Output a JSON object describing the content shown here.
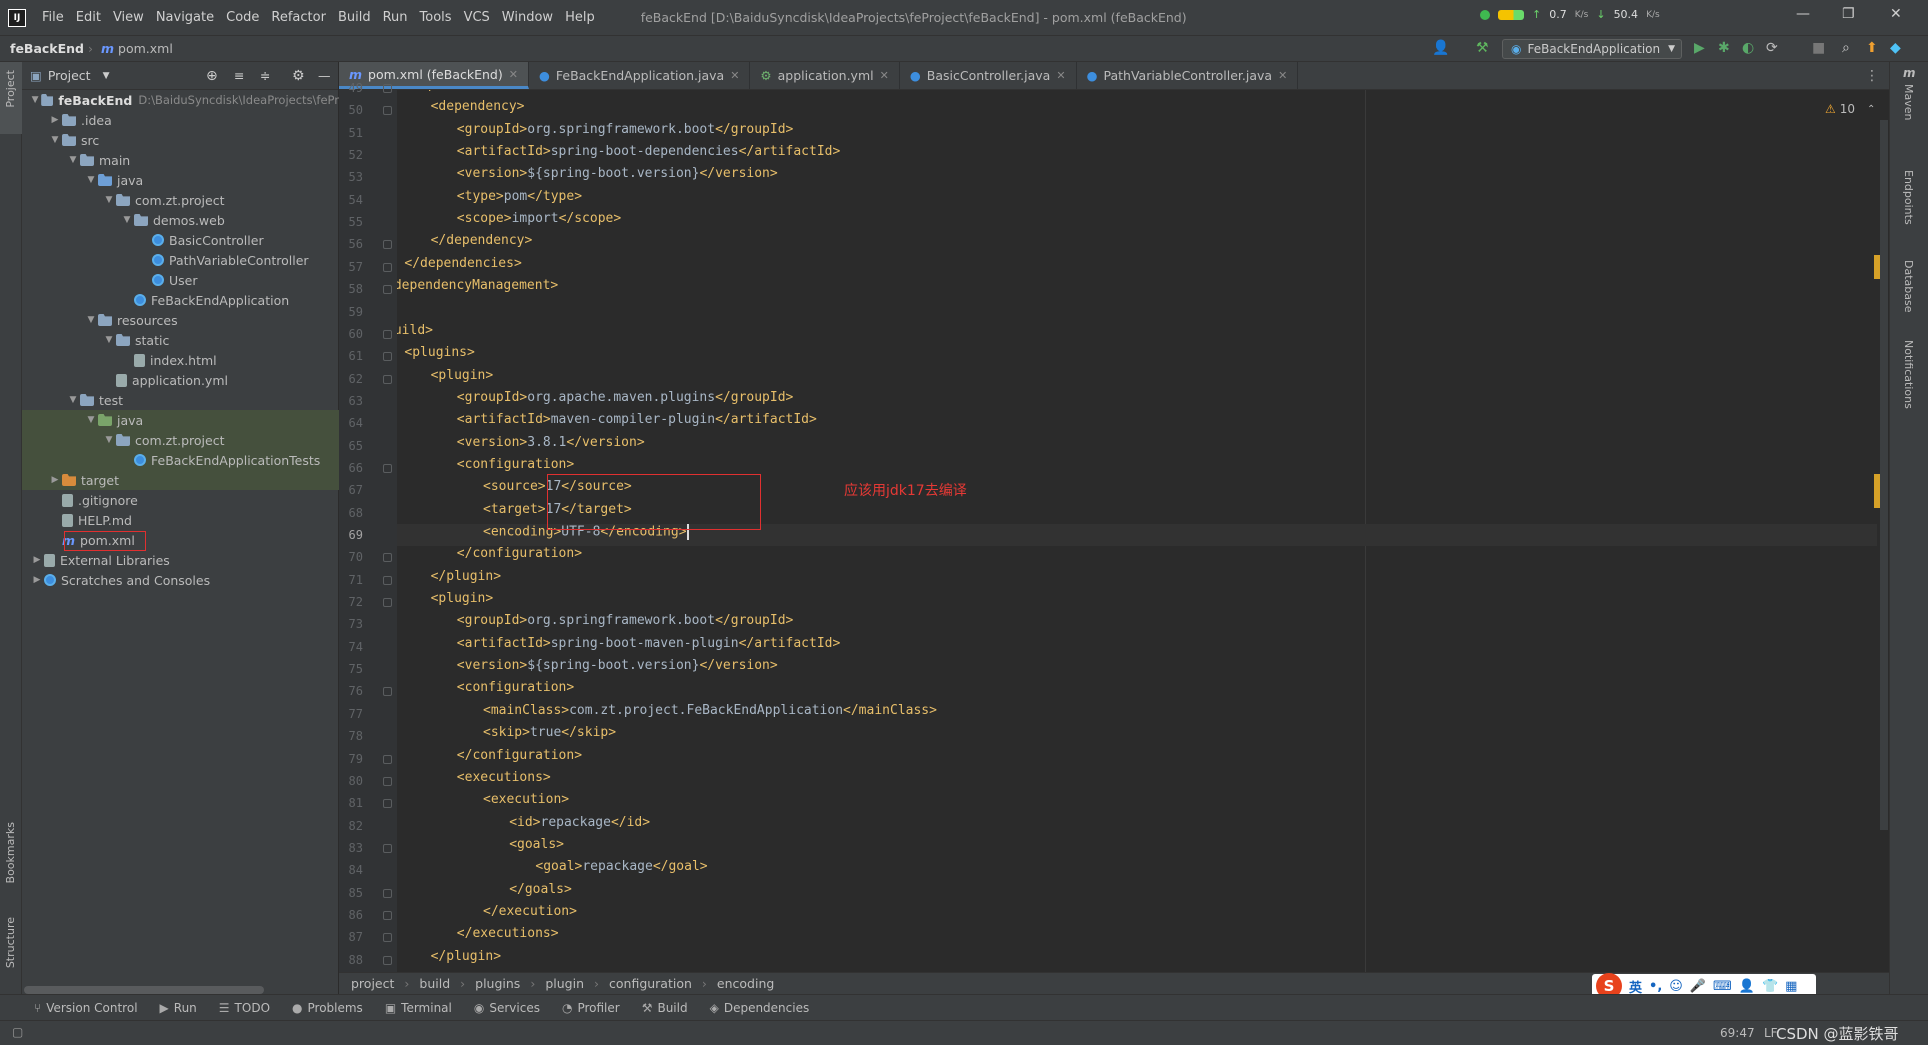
{
  "app": {
    "logo_text": "IJ",
    "menu": [
      "File",
      "Edit",
      "View",
      "Navigate",
      "Code",
      "Refactor",
      "Build",
      "Run",
      "Tools",
      "VCS",
      "Window",
      "Help"
    ],
    "window_title": "feBackEnd [D:\\BaiduSyncdisk\\IdeaProjects\\feProject\\feBackEnd] - pom.xml (feBackEnd)",
    "net_up": "0.7",
    "net_up_unit": "K/s",
    "net_down": "50.4",
    "net_down_unit": "K/s"
  },
  "navbar": {
    "project": "feBackEnd",
    "file": "pom.xml",
    "run_config": "FeBackEndApplication"
  },
  "project_panel": {
    "title": "Project",
    "tree": [
      {
        "label": "feBackEnd",
        "suffix": "D:\\BaiduSyncdisk\\IdeaProjects\\fePr",
        "icon": "folder-icon",
        "depth": 0,
        "expanded": true
      },
      {
        "label": ".idea",
        "icon": "folder-icon",
        "depth": 1,
        "expanded": false
      },
      {
        "label": "src",
        "icon": "folder-icon",
        "depth": 1,
        "expanded": true
      },
      {
        "label": "main",
        "icon": "folder-icon",
        "depth": 2,
        "expanded": true
      },
      {
        "label": "java",
        "icon": "source-folder-icon",
        "depth": 3,
        "expanded": true
      },
      {
        "label": "com.zt.project",
        "icon": "package-icon",
        "depth": 4,
        "expanded": true
      },
      {
        "label": "demos.web",
        "icon": "package-icon",
        "depth": 5,
        "expanded": true
      },
      {
        "label": "BasicController",
        "icon": "java-class-icon",
        "depth": 6
      },
      {
        "label": "PathVariableController",
        "icon": "java-class-icon",
        "depth": 6
      },
      {
        "label": "User",
        "icon": "java-class-icon",
        "depth": 6
      },
      {
        "label": "FeBackEndApplication",
        "icon": "spring-class-icon",
        "depth": 5
      },
      {
        "label": "resources",
        "icon": "resources-folder-icon",
        "depth": 3,
        "expanded": true
      },
      {
        "label": "static",
        "icon": "folder-icon",
        "depth": 4,
        "expanded": true
      },
      {
        "label": "index.html",
        "icon": "html-file-icon",
        "depth": 5
      },
      {
        "label": "application.yml",
        "icon": "yml-file-icon",
        "depth": 4
      },
      {
        "label": "test",
        "icon": "folder-icon",
        "depth": 2,
        "expanded": true
      },
      {
        "label": "java",
        "icon": "test-folder-icon",
        "depth": 3,
        "expanded": true
      },
      {
        "label": "com.zt.project",
        "icon": "package-icon",
        "depth": 4,
        "expanded": true
      },
      {
        "label": "FeBackEndApplicationTests",
        "icon": "spring-class-icon",
        "depth": 5
      },
      {
        "label": "target",
        "icon": "excluded-folder-icon",
        "depth": 1,
        "expanded": false
      },
      {
        "label": ".gitignore",
        "icon": "text-file-icon",
        "depth": 1
      },
      {
        "label": "HELP.md",
        "icon": "md-file-icon",
        "depth": 1
      },
      {
        "label": "pom.xml",
        "icon": "maven-file-icon",
        "depth": 1
      },
      {
        "label": "External Libraries",
        "icon": "library-icon",
        "depth": 0,
        "expanded": false
      },
      {
        "label": "Scratches and Consoles",
        "icon": "scratches-icon",
        "depth": 0,
        "expanded": false
      }
    ]
  },
  "tabs": [
    {
      "label": "pom.xml (feBackEnd)",
      "icon": "maven-file-icon",
      "active": true
    },
    {
      "label": "FeBackEndApplication.java",
      "icon": "spring-class-icon",
      "active": false
    },
    {
      "label": "application.yml",
      "icon": "yml-file-icon",
      "active": false
    },
    {
      "label": "BasicController.java",
      "icon": "java-class-icon",
      "active": false
    },
    {
      "label": "PathVariableController.java",
      "icon": "java-class-icon",
      "active": false
    }
  ],
  "editor": {
    "warnings": "10",
    "current_line": 69,
    "annotation": "应该用jdk17去编译",
    "lines": [
      {
        "n": 49,
        "indent": 2,
        "text": "<dependencies>"
      },
      {
        "n": 50,
        "indent": 3,
        "text": "<dependency>"
      },
      {
        "n": 51,
        "indent": 4,
        "text": "<groupId>org.springframework.boot</groupId>"
      },
      {
        "n": 52,
        "indent": 4,
        "text": "<artifactId>spring-boot-dependencies</artifactId>"
      },
      {
        "n": 53,
        "indent": 4,
        "text": "<version>${spring-boot.version}</version>"
      },
      {
        "n": 54,
        "indent": 4,
        "text": "<type>pom</type>"
      },
      {
        "n": 55,
        "indent": 4,
        "text": "<scope>import</scope>"
      },
      {
        "n": 56,
        "indent": 3,
        "text": "</dependency>"
      },
      {
        "n": 57,
        "indent": 2,
        "text": "</dependencies>"
      },
      {
        "n": 58,
        "indent": 1,
        "text": "</dependencyManagement>"
      },
      {
        "n": 59,
        "indent": 0,
        "text": ""
      },
      {
        "n": 60,
        "indent": 1,
        "text": "<build>"
      },
      {
        "n": 61,
        "indent": 2,
        "text": "<plugins>"
      },
      {
        "n": 62,
        "indent": 3,
        "text": "<plugin>"
      },
      {
        "n": 63,
        "indent": 4,
        "text": "<groupId>org.apache.maven.plugins</groupId>"
      },
      {
        "n": 64,
        "indent": 4,
        "text": "<artifactId>maven-compiler-plugin</artifactId>"
      },
      {
        "n": 65,
        "indent": 4,
        "text": "<version>3.8.1</version>"
      },
      {
        "n": 66,
        "indent": 4,
        "text": "<configuration>"
      },
      {
        "n": 67,
        "indent": 5,
        "text": "<source>17</source>"
      },
      {
        "n": 68,
        "indent": 5,
        "text": "<target>17</target>"
      },
      {
        "n": 69,
        "indent": 5,
        "text": "<encoding>UTF-8</encoding>"
      },
      {
        "n": 70,
        "indent": 4,
        "text": "</configuration>"
      },
      {
        "n": 71,
        "indent": 3,
        "text": "</plugin>"
      },
      {
        "n": 72,
        "indent": 3,
        "text": "<plugin>"
      },
      {
        "n": 73,
        "indent": 4,
        "text": "<groupId>org.springframework.boot</groupId>"
      },
      {
        "n": 74,
        "indent": 4,
        "text": "<artifactId>spring-boot-maven-plugin</artifactId>"
      },
      {
        "n": 75,
        "indent": 4,
        "text": "<version>${spring-boot.version}</version>"
      },
      {
        "n": 76,
        "indent": 4,
        "text": "<configuration>"
      },
      {
        "n": 77,
        "indent": 5,
        "text": "<mainClass>com.zt.project.FeBackEndApplication</mainClass>"
      },
      {
        "n": 78,
        "indent": 5,
        "text": "<skip>true</skip>"
      },
      {
        "n": 79,
        "indent": 4,
        "text": "</configuration>"
      },
      {
        "n": 80,
        "indent": 4,
        "text": "<executions>"
      },
      {
        "n": 81,
        "indent": 5,
        "text": "<execution>"
      },
      {
        "n": 82,
        "indent": 6,
        "text": "<id>repackage</id>"
      },
      {
        "n": 83,
        "indent": 6,
        "text": "<goals>"
      },
      {
        "n": 84,
        "indent": 7,
        "text": "<goal>repackage</goal>"
      },
      {
        "n": 85,
        "indent": 6,
        "text": "</goals>"
      },
      {
        "n": 86,
        "indent": 5,
        "text": "</execution>"
      },
      {
        "n": 87,
        "indent": 4,
        "text": "</executions>"
      },
      {
        "n": 88,
        "indent": 3,
        "text": "</plugin>"
      }
    ]
  },
  "breadcrumb": [
    "project",
    "build",
    "plugins",
    "plugin",
    "configuration",
    "encoding"
  ],
  "right_tools": [
    "Maven",
    "Endpoints",
    "Database",
    "Notifications"
  ],
  "left_tools": {
    "top": "Project",
    "bottom1": "Bookmarks",
    "bottom2": "Structure"
  },
  "bottom_tools": [
    {
      "label": "Version Control",
      "icon": "branch-icon"
    },
    {
      "label": "Run",
      "icon": "play-icon"
    },
    {
      "label": "TODO",
      "icon": "list-icon"
    },
    {
      "label": "Problems",
      "icon": "info-icon"
    },
    {
      "label": "Terminal",
      "icon": "terminal-icon"
    },
    {
      "label": "Services",
      "icon": "services-icon"
    },
    {
      "label": "Profiler",
      "icon": "profiler-icon"
    },
    {
      "label": "Build",
      "icon": "hammer-icon"
    },
    {
      "label": "Dependencies",
      "icon": "dependencies-icon"
    }
  ],
  "status": {
    "position": "69:47",
    "line_sep": "LF",
    "watermark": "CSDN @蓝影铁哥"
  },
  "ime": {
    "logo": "S",
    "mode": "英"
  },
  "colors": {
    "tag": "#e8bf6a",
    "text": "#a9b7c6",
    "annotation": "#e53935",
    "accent": "#4a88c7"
  }
}
